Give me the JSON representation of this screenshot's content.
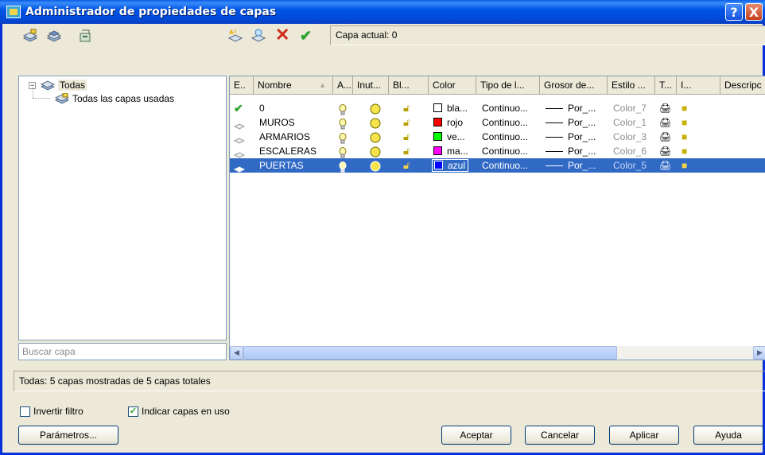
{
  "window": {
    "title": "Administrador de propiedades de capas",
    "help_btn": "?",
    "close_btn": "X"
  },
  "toolbar": {
    "current_layer": "Capa actual: 0"
  },
  "tree": {
    "root": "Todas",
    "child": "Todas las capas usadas"
  },
  "search": {
    "placeholder": "Buscar capa"
  },
  "columns": [
    "E..",
    "Nombre",
    "A...",
    "Inut...",
    "Bl...",
    "Color",
    "Tipo de l...",
    "Grosor de...",
    "Estilo ...",
    "T...",
    "I...",
    "Descripc"
  ],
  "layers": [
    {
      "name": "0",
      "color_hex": "#ffffff",
      "color_name": "bla...",
      "linetype": "Continuo...",
      "lineweight": "Por_...",
      "plot_style": "Color_7",
      "current": true
    },
    {
      "name": "MUROS",
      "color_hex": "#ff0000",
      "color_name": "rojo",
      "linetype": "Continuo...",
      "lineweight": "Por_...",
      "plot_style": "Color_1",
      "current": false
    },
    {
      "name": "ARMARIOS",
      "color_hex": "#00ff00",
      "color_name": "ve...",
      "linetype": "Continuo...",
      "lineweight": "Por_...",
      "plot_style": "Color_3",
      "current": false
    },
    {
      "name": "ESCALERAS",
      "color_hex": "#ff00ff",
      "color_name": "ma...",
      "linetype": "Continuo...",
      "lineweight": "Por_...",
      "plot_style": "Color_6",
      "current": false
    },
    {
      "name": "PUERTAS",
      "color_hex": "#0000ff",
      "color_name": "azul",
      "linetype": "Continuo...",
      "lineweight": "Por_...",
      "plot_style": "Color_5",
      "current": false,
      "selected": true
    }
  ],
  "status_text": "Todas: 5 capas mostradas de 5 capas totales",
  "options": {
    "invert_filter": "Invertir filtro",
    "indicate_used": "Indicar capas en uso",
    "invert_checked": false,
    "indicate_checked": true
  },
  "buttons": {
    "params": "Parámetros...",
    "ok": "Aceptar",
    "cancel": "Cancelar",
    "apply": "Aplicar",
    "help": "Ayuda"
  },
  "icons": [
    "new-property-filter-icon",
    "new-group-filter-icon",
    "layer-states-icon",
    "new-layer-icon",
    "new-layer-frozen-icon",
    "delete-layer-icon",
    "set-current-icon",
    "layer-on-bulb-icon",
    "layer-thaw-sun-icon",
    "lock-icon",
    "plot-printer-icon",
    "new-vp-freeze-icon",
    "current-check-icon",
    "layer-status-icon"
  ]
}
